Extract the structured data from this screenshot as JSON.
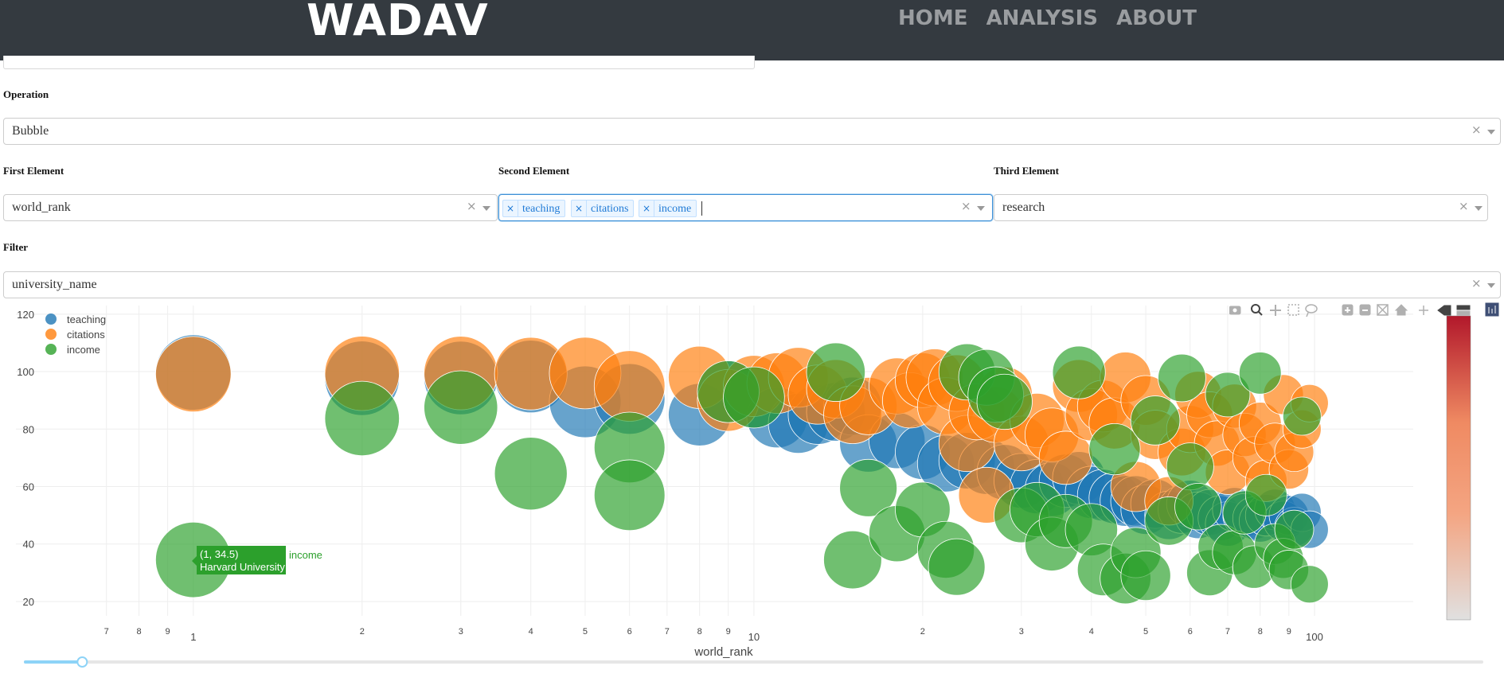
{
  "navbar": {
    "brand": "WADAV",
    "links": [
      "HOME",
      "ANALYSIS",
      "ABOUT"
    ]
  },
  "operation": {
    "label": "Operation",
    "value": "Bubble"
  },
  "first_element": {
    "label": "First Element",
    "value": "world_rank"
  },
  "second_element": {
    "label": "Second Element",
    "chips": [
      "teaching",
      "citations",
      "income"
    ]
  },
  "third_element": {
    "label": "Third Element",
    "value": "research"
  },
  "filter": {
    "label": "Filter",
    "value": "university_name"
  },
  "colors": {
    "teaching": "#1f77b4",
    "citations": "#ff7f0e",
    "income": "#2ca02c",
    "navbar": "#343a40",
    "accent": "#3d8fd6"
  },
  "icons": [
    "camera-icon",
    "zoom-icon",
    "pan-icon",
    "box-select-icon",
    "lasso-icon",
    "zoom-in-icon",
    "zoom-out-icon",
    "autoscale-icon",
    "reset-axes-icon",
    "spike-lines-icon",
    "hover-closest-icon",
    "hover-compare-icon",
    "plotly-logo-icon"
  ],
  "tooltip": {
    "coords": "(1, 34.5)",
    "name": "Harvard University",
    "series": "income"
  },
  "slider": {
    "value_fraction": 0.04
  },
  "chart_data": {
    "type": "scatter",
    "xlabel": "world_rank",
    "x_scale": "log",
    "xlim": [
      0.55,
      150
    ],
    "ylim": [
      15,
      123
    ],
    "x_ticks": [
      {
        "v": 0.7,
        "t": "7"
      },
      {
        "v": 0.8,
        "t": "8"
      },
      {
        "v": 0.9,
        "t": "9"
      },
      {
        "v": 1,
        "t": "1"
      },
      {
        "v": 2,
        "t": "2"
      },
      {
        "v": 3,
        "t": "3"
      },
      {
        "v": 4,
        "t": "4"
      },
      {
        "v": 5,
        "t": "5"
      },
      {
        "v": 6,
        "t": "6"
      },
      {
        "v": 7,
        "t": "7"
      },
      {
        "v": 8,
        "t": "8"
      },
      {
        "v": 9,
        "t": "9"
      },
      {
        "v": 10,
        "t": "10"
      },
      {
        "v": 20,
        "t": "2"
      },
      {
        "v": 30,
        "t": "3"
      },
      {
        "v": 40,
        "t": "4"
      },
      {
        "v": 50,
        "t": "5"
      },
      {
        "v": 60,
        "t": "6"
      },
      {
        "v": 70,
        "t": "7"
      },
      {
        "v": 80,
        "t": "8"
      },
      {
        "v": 90,
        "t": "9"
      },
      {
        "v": 100,
        "t": "100"
      }
    ],
    "y_ticks": [
      20,
      40,
      60,
      80,
      100,
      120
    ],
    "legend_position": "top-left",
    "size_encodes": "research",
    "series": [
      {
        "name": "teaching",
        "points": [
          [
            1,
            99.7
          ],
          [
            2,
            97.7
          ],
          [
            3,
            97.8
          ],
          [
            4,
            98.3
          ],
          [
            5,
            89.5
          ],
          [
            6,
            90.5
          ],
          [
            8,
            85
          ],
          [
            9,
            93
          ],
          [
            10,
            91
          ],
          [
            11,
            84
          ],
          [
            12,
            82
          ],
          [
            13,
            85
          ],
          [
            14,
            86
          ],
          [
            15,
            88
          ],
          [
            16,
            75
          ],
          [
            18,
            76
          ],
          [
            20,
            72
          ],
          [
            22,
            68
          ],
          [
            24,
            69
          ],
          [
            26,
            67
          ],
          [
            28,
            65
          ],
          [
            30,
            62
          ],
          [
            32,
            60
          ],
          [
            34,
            59
          ],
          [
            36,
            62
          ],
          [
            38,
            63
          ],
          [
            40,
            58
          ],
          [
            42,
            57
          ],
          [
            44,
            56
          ],
          [
            46,
            55
          ],
          [
            48,
            55
          ],
          [
            50,
            52
          ],
          [
            52,
            54
          ],
          [
            55,
            50
          ],
          [
            58,
            52
          ],
          [
            60,
            54
          ],
          [
            62,
            50
          ],
          [
            65,
            51
          ],
          [
            68,
            49
          ],
          [
            70,
            47
          ],
          [
            72,
            52
          ],
          [
            75,
            50
          ],
          [
            78,
            49
          ],
          [
            80,
            48
          ],
          [
            82,
            50
          ],
          [
            85,
            52
          ],
          [
            88,
            48
          ],
          [
            90,
            50
          ],
          [
            92,
            46
          ],
          [
            95,
            51
          ],
          [
            98,
            45
          ]
        ]
      },
      {
        "name": "citations",
        "points": [
          [
            1,
            99.1
          ],
          [
            2,
            99.4
          ],
          [
            3,
            99.5
          ],
          [
            4,
            99.3
          ],
          [
            5,
            99.5
          ],
          [
            6,
            95
          ],
          [
            8,
            98
          ],
          [
            9,
            90
          ],
          [
            10,
            95
          ],
          [
            11,
            96
          ],
          [
            12,
            98
          ],
          [
            13,
            92
          ],
          [
            14,
            94
          ],
          [
            15,
            85
          ],
          [
            16,
            88
          ],
          [
            18,
            95
          ],
          [
            19,
            90
          ],
          [
            20,
            97
          ],
          [
            21,
            98
          ],
          [
            22,
            88
          ],
          [
            23,
            96
          ],
          [
            24,
            75
          ],
          [
            25,
            86
          ],
          [
            26,
            57
          ],
          [
            27,
            85
          ],
          [
            28,
            92
          ],
          [
            30,
            75
          ],
          [
            32,
            83
          ],
          [
            34,
            78
          ],
          [
            36,
            70
          ],
          [
            38,
            95
          ],
          [
            40,
            85
          ],
          [
            42,
            88
          ],
          [
            44,
            82
          ],
          [
            46,
            98
          ],
          [
            48,
            60
          ],
          [
            50,
            90
          ],
          [
            52,
            78
          ],
          [
            55,
            55
          ],
          [
            58,
            72
          ],
          [
            60,
            80
          ],
          [
            62,
            92
          ],
          [
            65,
            85
          ],
          [
            67,
            75
          ],
          [
            70,
            65
          ],
          [
            72,
            88
          ],
          [
            75,
            78
          ],
          [
            78,
            70
          ],
          [
            80,
            82
          ],
          [
            82,
            62
          ],
          [
            85,
            75
          ],
          [
            88,
            92
          ],
          [
            90,
            66
          ],
          [
            92,
            72
          ],
          [
            95,
            80
          ],
          [
            98,
            89
          ]
        ]
      },
      {
        "name": "income",
        "points": [
          [
            1,
            34.5
          ],
          [
            2,
            83.7
          ],
          [
            3,
            87.5
          ],
          [
            4,
            64.5
          ],
          [
            6,
            73.6
          ],
          [
            6,
            57
          ],
          [
            9,
            93
          ],
          [
            10,
            91
          ],
          [
            14,
            99.8
          ],
          [
            15,
            34.5
          ],
          [
            16,
            59.5
          ],
          [
            18,
            43.6
          ],
          [
            20,
            52
          ],
          [
            22,
            38
          ],
          [
            23,
            32
          ],
          [
            24,
            99.9
          ],
          [
            26,
            98
          ],
          [
            27,
            92
          ],
          [
            28,
            89.5
          ],
          [
            30,
            50
          ],
          [
            32,
            52
          ],
          [
            34,
            40
          ],
          [
            36,
            48
          ],
          [
            38,
            99.7
          ],
          [
            40,
            45
          ],
          [
            42,
            31
          ],
          [
            44,
            73
          ],
          [
            46,
            28
          ],
          [
            48,
            37
          ],
          [
            50,
            29
          ],
          [
            52,
            83
          ],
          [
            55,
            48
          ],
          [
            58,
            97.8
          ],
          [
            60,
            67
          ],
          [
            62,
            53
          ],
          [
            65,
            30
          ],
          [
            68,
            39
          ],
          [
            70,
            92
          ],
          [
            72,
            37
          ],
          [
            75,
            51
          ],
          [
            78,
            32
          ],
          [
            80,
            99.5
          ],
          [
            82,
            57
          ],
          [
            85,
            40
          ],
          [
            88,
            35
          ],
          [
            90,
            31
          ],
          [
            92,
            45
          ],
          [
            95,
            84.5
          ],
          [
            98,
            26
          ]
        ]
      }
    ]
  }
}
